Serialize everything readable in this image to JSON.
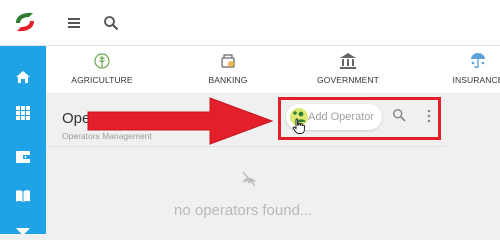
{
  "header": {
    "icons": [
      "logo-icon",
      "menu-icon",
      "search-icon"
    ]
  },
  "sidebar": {
    "items": [
      {
        "icon": "home-icon"
      },
      {
        "icon": "apps-grid-icon"
      },
      {
        "icon": "wallet-icon"
      },
      {
        "icon": "book-icon"
      },
      {
        "icon": "filter-icon"
      }
    ]
  },
  "categories": [
    {
      "label": "AGRICULTURE",
      "icon": "agriculture-icon"
    },
    {
      "label": "BANKING",
      "icon": "banking-icon"
    },
    {
      "label": "GOVERNMENT",
      "icon": "government-icon"
    },
    {
      "label": "INSURANCE",
      "icon": "insurance-icon"
    }
  ],
  "page": {
    "title": "Operators",
    "subtitle": "Operators Management"
  },
  "toolbar": {
    "add_label": "Add Operator"
  },
  "empty_state": {
    "message": "no operators found..."
  },
  "colors": {
    "accent": "#1fa2e6",
    "highlight": "#e3202a",
    "add_icon_bg": "#dcea74"
  }
}
